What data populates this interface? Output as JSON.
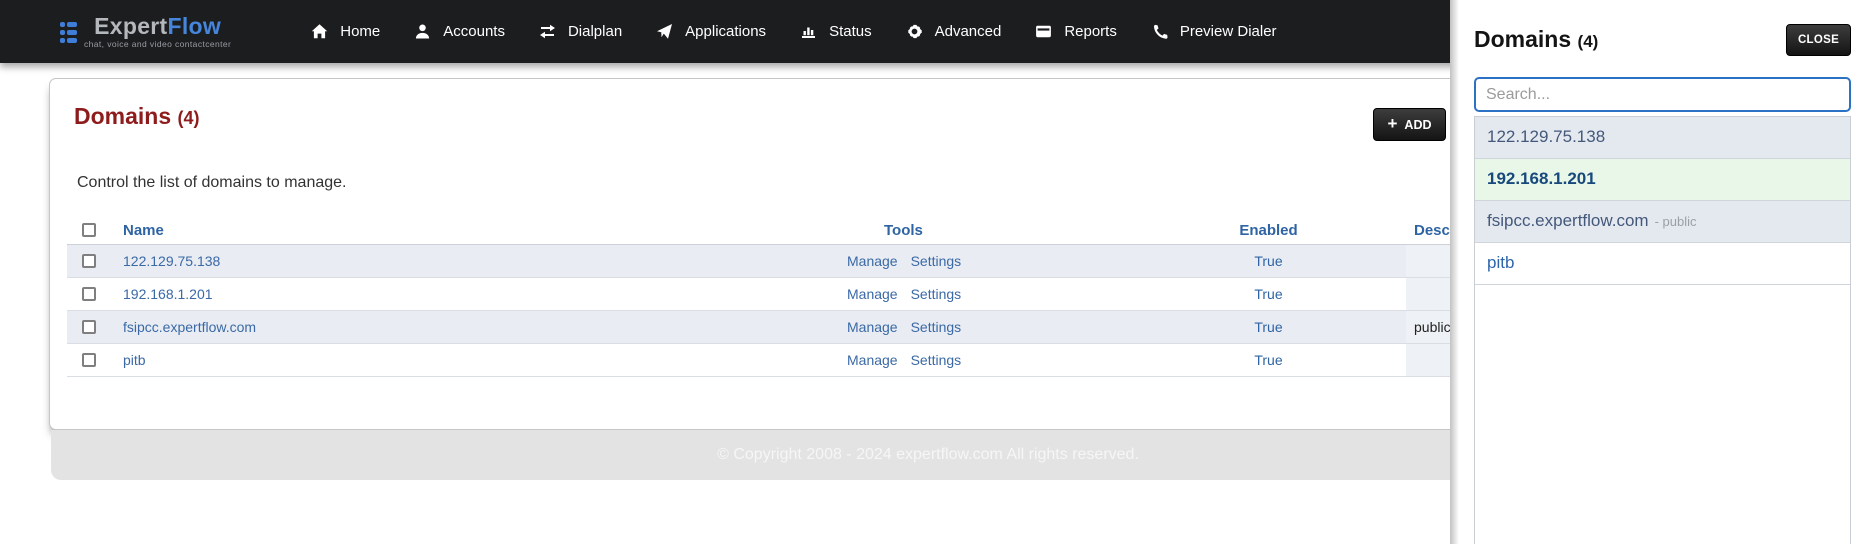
{
  "brand": {
    "name_primary": "Expert",
    "name_secondary": "Flow",
    "tagline": "chat, voice and video contactcenter"
  },
  "nav": {
    "items": [
      {
        "label": "Home",
        "icon": "home-icon"
      },
      {
        "label": "Accounts",
        "icon": "user-icon"
      },
      {
        "label": "Dialplan",
        "icon": "swap-arrows-icon"
      },
      {
        "label": "Applications",
        "icon": "paper-plane-icon"
      },
      {
        "label": "Status",
        "icon": "bar-chart-icon"
      },
      {
        "label": "Advanced",
        "icon": "gear-icon"
      },
      {
        "label": "Reports",
        "icon": "drive-icon"
      },
      {
        "label": "Preview Dialer",
        "icon": "phone-icon"
      }
    ]
  },
  "main": {
    "title": "Domains",
    "count": "(4)",
    "subtitle": "Control the list of domains to manage.",
    "add_button_plus": "+",
    "add_button": "ADD",
    "table": {
      "headers": {
        "name": "Name",
        "tools": "Tools",
        "enabled": "Enabled",
        "description": "Description"
      },
      "manage_label": "Manage",
      "settings_label": "Settings",
      "rows": [
        {
          "name": "122.129.75.138",
          "enabled": "True",
          "description": ""
        },
        {
          "name": "192.168.1.201",
          "enabled": "True",
          "description": ""
        },
        {
          "name": "fsipcc.expertflow.com",
          "enabled": "True",
          "description": "public"
        },
        {
          "name": "pitb",
          "enabled": "True",
          "description": ""
        }
      ]
    }
  },
  "footer": {
    "copyright": "© Copyright 2008 - 2024 expertflow.com All rights reserved."
  },
  "drawer": {
    "title": "Domains",
    "count": "(4)",
    "close_button": "CLOSE",
    "search_placeholder": "Search...",
    "items": [
      {
        "label": "122.129.75.138",
        "suffix": ""
      },
      {
        "label": "192.168.1.201",
        "suffix": ""
      },
      {
        "label": "fsipcc.expertflow.com",
        "suffix": "- public"
      },
      {
        "label": "pitb",
        "suffix": ""
      }
    ]
  },
  "colors": {
    "nav_bg": "#1c1d1f",
    "brand_blue": "#3e7ed8",
    "heading_maroon": "#8e1c1c",
    "table_header_blue": "#2e64a3",
    "link_blue": "#3a69a5",
    "stripe": "#e9edf3",
    "selected_green": "#e9f7e8",
    "search_border_blue": "#2b72c4"
  }
}
